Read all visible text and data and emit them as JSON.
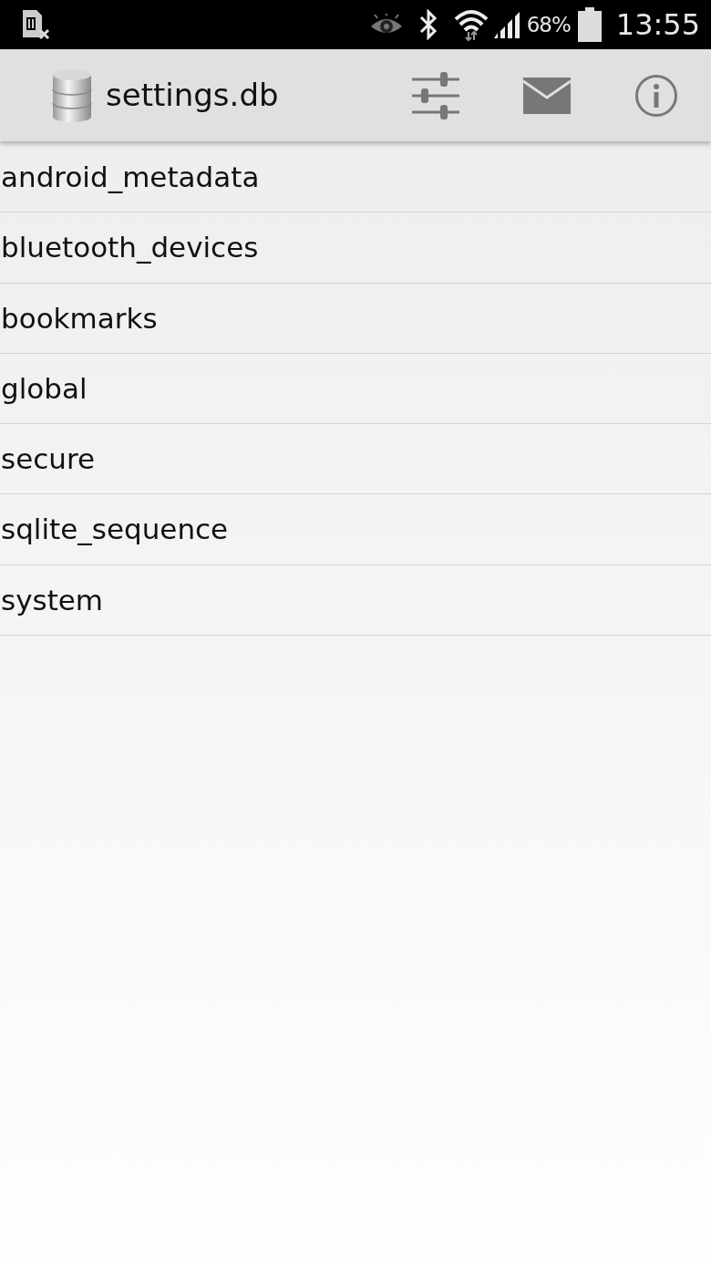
{
  "status_bar": {
    "battery": "68%",
    "time": "13:55"
  },
  "toolbar": {
    "title": "settings.db"
  },
  "tables": [
    {
      "name": "android_metadata"
    },
    {
      "name": "bluetooth_devices"
    },
    {
      "name": "bookmarks"
    },
    {
      "name": "global"
    },
    {
      "name": "secure"
    },
    {
      "name": "sqlite_sequence"
    },
    {
      "name": "system"
    }
  ]
}
